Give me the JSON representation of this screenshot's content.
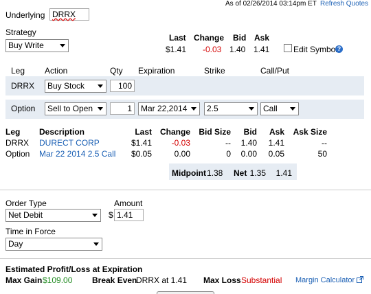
{
  "header": {
    "underlying_label": "Underlying",
    "underlying_value": "DRRX",
    "as_of": "As of 02/26/2014 03:14pm ET",
    "refresh": "Refresh Quotes"
  },
  "strategy": {
    "label": "Strategy",
    "value": "Buy Write"
  },
  "quote": {
    "headers": [
      "Last",
      "Change",
      "Bid",
      "Ask"
    ],
    "last": "$1.41",
    "change": "-0.03",
    "bid": "1.40",
    "ask": "1.41",
    "edit_symbol": "Edit Symbol"
  },
  "leg_headers": {
    "leg": "Leg",
    "action": "Action",
    "qty": "Qty",
    "expiration": "Expiration",
    "strike": "Strike",
    "callput": "Call/Put"
  },
  "leg1": {
    "leg": "DRRX",
    "action": "Buy Stock",
    "qty": "100"
  },
  "leg2": {
    "leg": "Option",
    "action": "Sell to Open",
    "qty": "1",
    "expiration": "Mar 22,2014",
    "strike": "2.5",
    "callput": "Call"
  },
  "detail": {
    "headers": [
      "Leg",
      "Description",
      "Last",
      "Change",
      "Bid Size",
      "Bid",
      "Ask",
      "Ask Size"
    ],
    "rows": [
      {
        "leg": "DRRX",
        "description": "DURECT CORP",
        "last": "$1.41",
        "change": "-0.03",
        "bid_size": "--",
        "bid": "1.40",
        "ask": "1.41",
        "ask_size": "--"
      },
      {
        "leg": "Option",
        "description": "Mar 22 2014 2.5 Call",
        "last": "$0.05",
        "change": "0.00",
        "bid_size": "0",
        "bid": "0.00",
        "ask": "0.05",
        "ask_size": "50"
      }
    ],
    "midpoint_label": "Midpoint",
    "midpoint_value": "1.38",
    "net_label": "Net",
    "net_bid": "1.35",
    "net_ask": "1.41"
  },
  "order": {
    "type_label": "Order Type",
    "type_value": "Net Debit",
    "amount_label": "Amount",
    "currency": "$",
    "amount_value": "1.41",
    "tif_label": "Time in Force",
    "tif_value": "Day"
  },
  "pl": {
    "title": "Estimated Profit/Loss at Expiration",
    "max_gain_label": "Max Gain",
    "max_gain_value": "$109.00",
    "break_even_label": "Break Even",
    "break_even_value": "DRRX at 1.41",
    "max_loss_label": "Max Loss",
    "max_loss_value": "Substantial",
    "margin_calc": "Margin Calculator"
  },
  "colors": {
    "accent": "#1a5fb4",
    "negative": "#d40000",
    "positive": "#1f8a1f",
    "band": "#e6ecf3"
  }
}
